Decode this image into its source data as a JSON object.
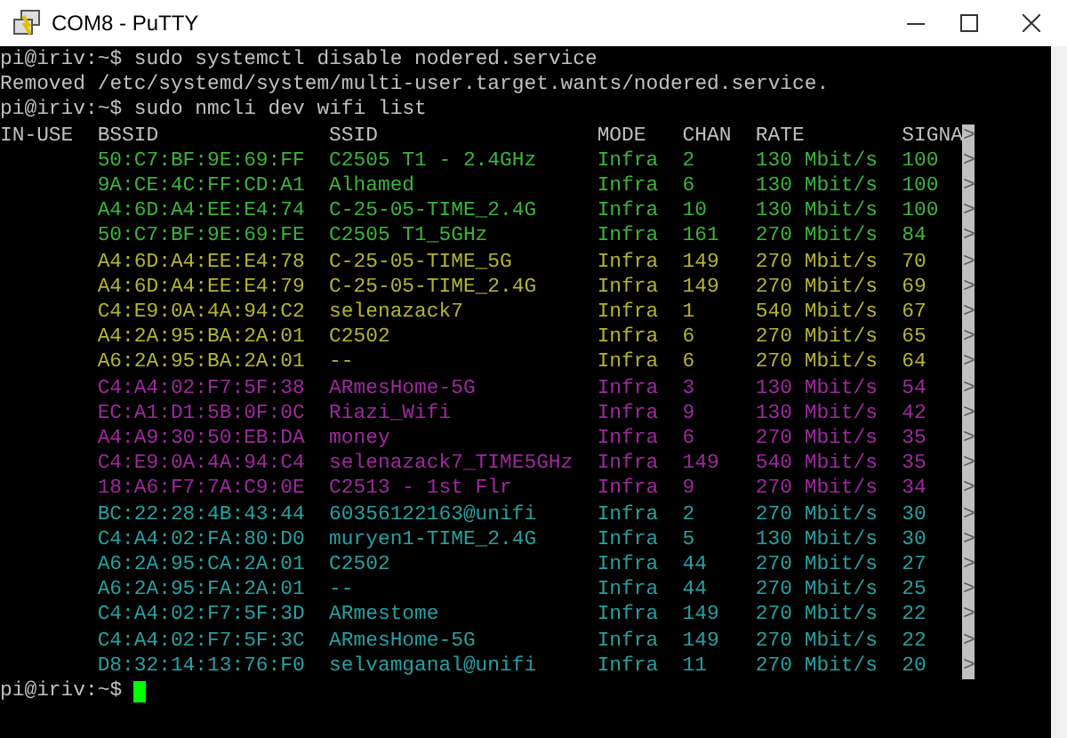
{
  "window": {
    "title": "COM8 - PuTTY"
  },
  "terminal": {
    "lines": [
      {
        "text": "pi@iriv:~$ sudo systemctl disable nodered.service"
      },
      {
        "text": "Removed /etc/systemd/system/multi-user.target.wants/nodered.service."
      },
      {
        "text": "pi@iriv:~$ sudo nmcli dev wifi list"
      }
    ],
    "table": {
      "columns": [
        "IN-USE",
        "BSSID",
        "SSID",
        "MODE",
        "CHAN",
        "RATE",
        "SIGNA"
      ],
      "header_marker": ">",
      "rows": [
        {
          "bssid": "50:C7:BF:9E:69:FF",
          "ssid": "C2505 T1 - 2.4GHz",
          "mode": "Infra",
          "chan": "2",
          "rate": "130 Mbit/s",
          "signal": "100",
          "marker": ">",
          "color": "#3cb43c"
        },
        {
          "bssid": "9A:CE:4C:FF:CD:A1",
          "ssid": "Alhamed",
          "mode": "Infra",
          "chan": "6",
          "rate": "130 Mbit/s",
          "signal": "100",
          "marker": ">",
          "color": "#3cb43c"
        },
        {
          "bssid": "A4:6D:A4:EE:E4:74",
          "ssid": "C-25-05-TIME_2.4G",
          "mode": "Infra",
          "chan": "10",
          "rate": "130 Mbit/s",
          "signal": "100",
          "marker": ">",
          "color": "#3cb43c"
        },
        {
          "bssid": "50:C7:BF:9E:69:FE",
          "ssid": "C2505 T1_5GHz",
          "mode": "Infra",
          "chan": "161",
          "rate": "270 Mbit/s",
          "signal": "84",
          "marker": ">",
          "color": "#3cb43c"
        },
        {
          "bssid": "A4:6D:A4:EE:E4:78",
          "ssid": "C-25-05-TIME_5G",
          "mode": "Infra",
          "chan": "149",
          "rate": "270 Mbit/s",
          "signal": "70",
          "marker": ">",
          "color": "#b4b432"
        },
        {
          "bssid": "A4:6D:A4:EE:E4:79",
          "ssid": "C-25-05-TIME_2.4G",
          "mode": "Infra",
          "chan": "149",
          "rate": "270 Mbit/s",
          "signal": "69",
          "marker": ">",
          "color": "#b4b432"
        },
        {
          "bssid": "C4:E9:0A:4A:94:C2",
          "ssid": "selenazack7",
          "mode": "Infra",
          "chan": "1",
          "rate": "540 Mbit/s",
          "signal": "67",
          "marker": ">",
          "color": "#b4b432"
        },
        {
          "bssid": "A4:2A:95:BA:2A:01",
          "ssid": "C2502",
          "mode": "Infra",
          "chan": "6",
          "rate": "270 Mbit/s",
          "signal": "65",
          "marker": ">",
          "color": "#b4b432"
        },
        {
          "bssid": "A6:2A:95:BA:2A:01",
          "ssid": "--",
          "mode": "Infra",
          "chan": "6",
          "rate": "270 Mbit/s",
          "signal": "64",
          "marker": ">",
          "color": "#b4b432"
        },
        {
          "bssid": "C4:A4:02:F7:5F:38",
          "ssid": "ARmesHome-5G",
          "mode": "Infra",
          "chan": "3",
          "rate": "130 Mbit/s",
          "signal": "54",
          "marker": ">",
          "color": "#a028a0"
        },
        {
          "bssid": "EC:A1:D1:5B:0F:0C",
          "ssid": "Riazi_Wifi",
          "mode": "Infra",
          "chan": "9",
          "rate": "130 Mbit/s",
          "signal": "42",
          "marker": ">",
          "color": "#a028a0"
        },
        {
          "bssid": "A4:A9:30:50:EB:DA",
          "ssid": "money",
          "mode": "Infra",
          "chan": "6",
          "rate": "270 Mbit/s",
          "signal": "35",
          "marker": ">",
          "color": "#a028a0"
        },
        {
          "bssid": "C4:E9:0A:4A:94:C4",
          "ssid": "selenazack7_TIME5GHz",
          "mode": "Infra",
          "chan": "149",
          "rate": "540 Mbit/s",
          "signal": "35",
          "marker": ">",
          "color": "#a028a0"
        },
        {
          "bssid": "18:A6:F7:7A:C9:0E",
          "ssid": "C2513 - 1st Flr",
          "mode": "Infra",
          "chan": "9",
          "rate": "270 Mbit/s",
          "signal": "34",
          "marker": ">",
          "color": "#a028a0"
        },
        {
          "bssid": "BC:22:28:4B:43:44",
          "ssid": "60356122163@unifi",
          "mode": "Infra",
          "chan": "2",
          "rate": "270 Mbit/s",
          "signal": "30",
          "marker": ">",
          "color": "#28a0a0"
        },
        {
          "bssid": "C4:A4:02:FA:80:D0",
          "ssid": "muryen1-TIME_2.4G",
          "mode": "Infra",
          "chan": "5",
          "rate": "130 Mbit/s",
          "signal": "30",
          "marker": ">",
          "color": "#28a0a0"
        },
        {
          "bssid": "A6:2A:95:CA:2A:01",
          "ssid": "C2502",
          "mode": "Infra",
          "chan": "44",
          "rate": "270 Mbit/s",
          "signal": "27",
          "marker": ">",
          "color": "#28a0a0"
        },
        {
          "bssid": "A6:2A:95:FA:2A:01",
          "ssid": "--",
          "mode": "Infra",
          "chan": "44",
          "rate": "270 Mbit/s",
          "signal": "25",
          "marker": ">",
          "color": "#28a0a0"
        },
        {
          "bssid": "C4:A4:02:F7:5F:3D",
          "ssid": "ARmestome",
          "mode": "Infra",
          "chan": "149",
          "rate": "270 Mbit/s",
          "signal": "22",
          "marker": ">",
          "color": "#28a0a0"
        },
        {
          "bssid": "C4:A4:02:F7:5F:3C",
          "ssid": "ARmesHome-5G",
          "mode": "Infra",
          "chan": "149",
          "rate": "270 Mbit/s",
          "signal": "22",
          "marker": ">",
          "color": "#28a0a0"
        },
        {
          "bssid": "D8:32:14:13:76:F0",
          "ssid": "selvamganal@unifi",
          "mode": "Infra",
          "chan": "11",
          "rate": "270 Mbit/s",
          "signal": "20",
          "marker": ">",
          "color": "#28a0a0"
        }
      ]
    },
    "prompt": "pi@iriv:~$"
  }
}
